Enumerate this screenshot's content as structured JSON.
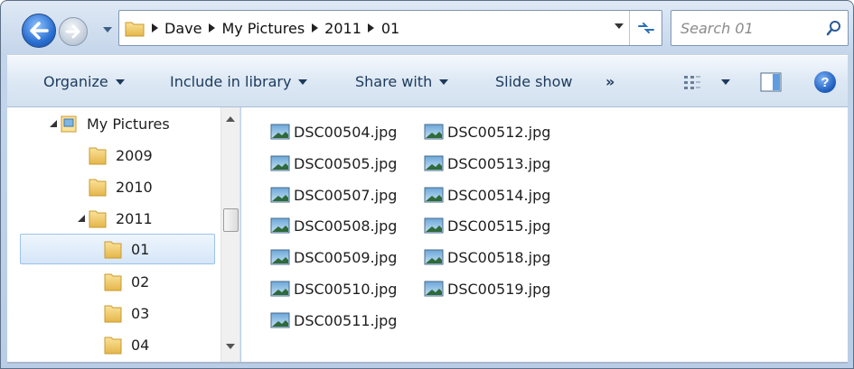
{
  "address": {
    "crumbs": [
      "Dave",
      "My Pictures",
      "2011",
      "01"
    ]
  },
  "search": {
    "placeholder": "Search 01"
  },
  "commands": {
    "organize": "Organize",
    "include_in_library": "Include in library",
    "share_with": "Share with",
    "slide_show": "Slide show",
    "more": "»"
  },
  "tree": {
    "root": "My Pictures",
    "items": [
      "2009",
      "2010",
      "2011",
      "01",
      "02",
      "03",
      "04"
    ]
  },
  "files": {
    "column1": [
      "DSC00504.jpg",
      "DSC00505.jpg",
      "DSC00507.jpg",
      "DSC00508.jpg",
      "DSC00509.jpg",
      "DSC00510.jpg",
      "DSC00511.jpg"
    ],
    "column2": [
      "DSC00512.jpg",
      "DSC00513.jpg",
      "DSC00514.jpg",
      "DSC00515.jpg",
      "DSC00518.jpg",
      "DSC00519.jpg"
    ]
  },
  "icons": {
    "back": "back-arrow-icon",
    "forward": "forward-arrow-icon",
    "folder": "folder-icon",
    "image": "image-file-icon",
    "search": "search-icon",
    "help": "help-icon"
  },
  "colors": {
    "accent": "#2a6fd1",
    "selection": "#d5e6f8",
    "command_text": "#1c3a5c"
  }
}
